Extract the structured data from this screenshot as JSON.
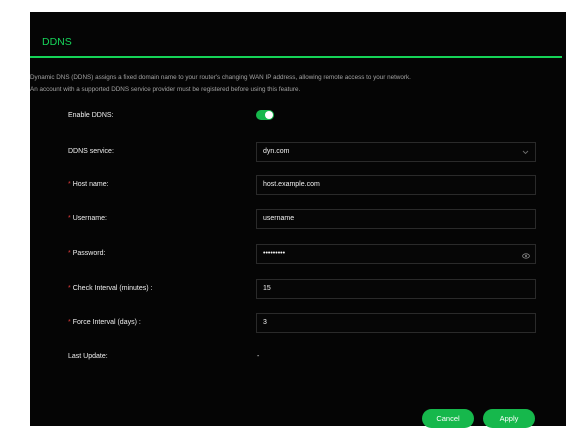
{
  "section": {
    "title": "DDNS"
  },
  "description": {
    "line1": "Dynamic DNS (DDNS) assigns a fixed domain name to your router's changing WAN IP address, allowing remote access to your network.",
    "line2": "An account with a supported DDNS service provider must be registered before using this feature."
  },
  "fields": {
    "enable": {
      "label": "Enable DDNS:",
      "state": "on"
    },
    "service": {
      "label": "DDNS service:",
      "value": "dyn.com",
      "icon": "chevron-down-icon"
    },
    "host": {
      "label": "Host name:",
      "required_mark": "*",
      "value": "host.example.com"
    },
    "username": {
      "label": "Username:",
      "required_mark": "*",
      "value": "username"
    },
    "password": {
      "label": "Password:",
      "required_mark": "*",
      "value": "•••••••••",
      "icon": "eye-icon"
    },
    "check_interval": {
      "label": "Check Interval (minutes) :",
      "required_mark": "*",
      "value": "15"
    },
    "force_interval": {
      "label": "Force Interval (days) :",
      "required_mark": "*",
      "value": "3"
    },
    "last_update": {
      "label": "Last Update:",
      "value": "-"
    }
  },
  "buttons": {
    "cancel": "Cancel",
    "apply": "Apply"
  },
  "colors": {
    "accent": "#16b84c",
    "title": "#17d45a",
    "background": "#050505",
    "required": "#e23b3b"
  }
}
